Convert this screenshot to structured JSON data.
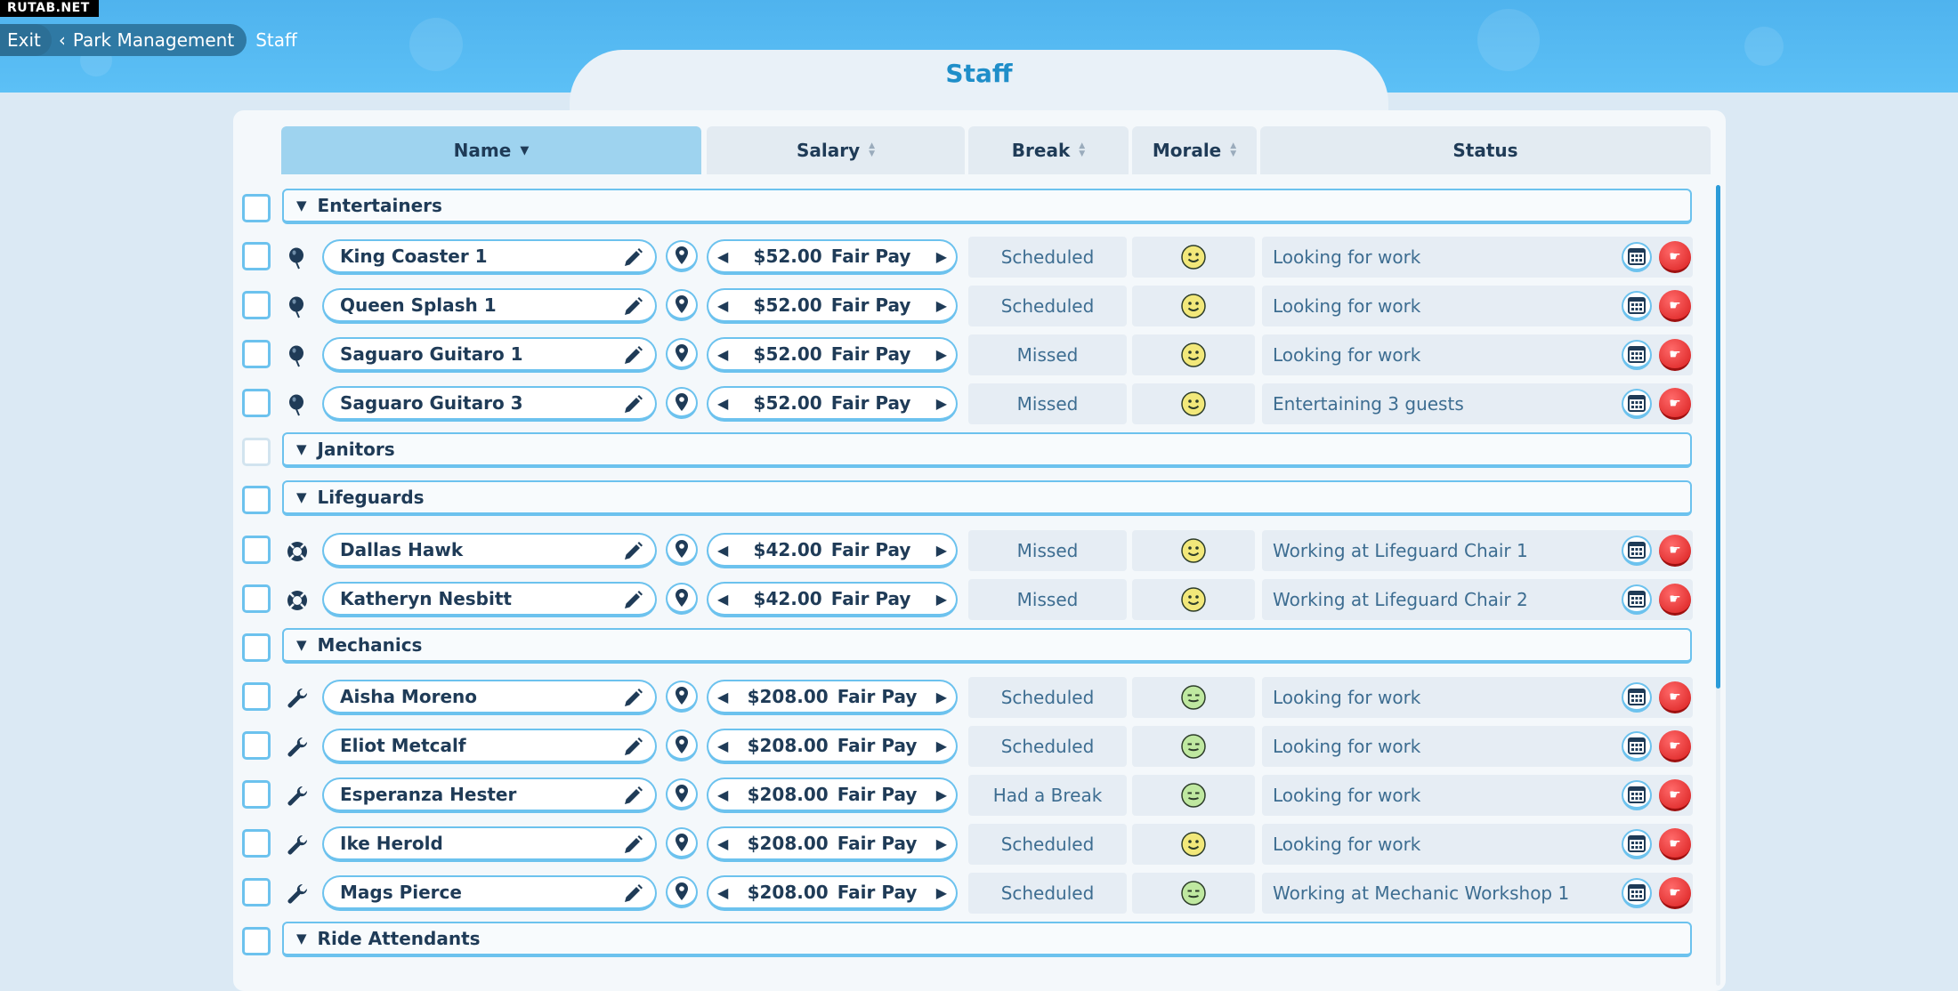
{
  "watermark": "RUTAB.NET",
  "breadcrumb": {
    "exit": "Exit",
    "parent": "Park Management",
    "current": "Staff"
  },
  "title": "Staff",
  "columns": {
    "name": "Name",
    "salary": "Salary",
    "break": "Break",
    "morale": "Morale",
    "status": "Status"
  },
  "groups": {
    "entertainers": "Entertainers",
    "janitors": "Janitors",
    "lifeguards": "Lifeguards",
    "mechanics": "Mechanics",
    "ride_attendants": "Ride Attendants"
  },
  "pay_label": "Fair Pay",
  "staff": [
    {
      "name": "King Coaster 1",
      "salary": "$52.00",
      "break": "Scheduled",
      "morale": "happy",
      "status": "Looking for work",
      "icon": "balloon-icon"
    },
    {
      "name": "Queen Splash 1",
      "salary": "$52.00",
      "break": "Scheduled",
      "morale": "happy",
      "status": "Looking for work",
      "icon": "balloon-icon"
    },
    {
      "name": "Saguaro Guitaro 1",
      "salary": "$52.00",
      "break": "Missed",
      "morale": "happy",
      "status": "Looking for work",
      "icon": "balloon-icon"
    },
    {
      "name": "Saguaro Guitaro 3",
      "salary": "$52.00",
      "break": "Missed",
      "morale": "happy",
      "status": "Entertaining 3 guests",
      "icon": "balloon-icon"
    },
    {
      "name": "Dallas Hawk",
      "salary": "$42.00",
      "break": "Missed",
      "morale": "happy",
      "status": "Working at Lifeguard Chair 1",
      "icon": "lifebuoy-icon"
    },
    {
      "name": "Katheryn Nesbitt",
      "salary": "$42.00",
      "break": "Missed",
      "morale": "happy",
      "status": "Working at Lifeguard Chair 2",
      "icon": "lifebuoy-icon"
    },
    {
      "name": "Aisha Moreno",
      "salary": "$208.00",
      "break": "Scheduled",
      "morale": "content",
      "status": "Looking for work",
      "icon": "wrench-icon"
    },
    {
      "name": "Eliot Metcalf",
      "salary": "$208.00",
      "break": "Scheduled",
      "morale": "content",
      "status": "Looking for work",
      "icon": "wrench-icon"
    },
    {
      "name": "Esperanza Hester",
      "salary": "$208.00",
      "break": "Had a Break",
      "morale": "content",
      "status": "Looking for work",
      "icon": "wrench-icon"
    },
    {
      "name": "Ike Herold",
      "salary": "$208.00",
      "break": "Scheduled",
      "morale": "happy",
      "status": "Looking for work",
      "icon": "wrench-icon"
    },
    {
      "name": "Mags Pierce",
      "salary": "$208.00",
      "break": "Scheduled",
      "morale": "content",
      "status": "Working at Mechanic Workshop 1",
      "icon": "wrench-icon"
    }
  ],
  "colors": {
    "accent": "#6cc2ee",
    "header_active": "#9ed3ef",
    "fire": "#e02b2b",
    "happy_face": "#f2e87a",
    "content_face": "#bfe8a0",
    "title": "#1f8ec9"
  }
}
